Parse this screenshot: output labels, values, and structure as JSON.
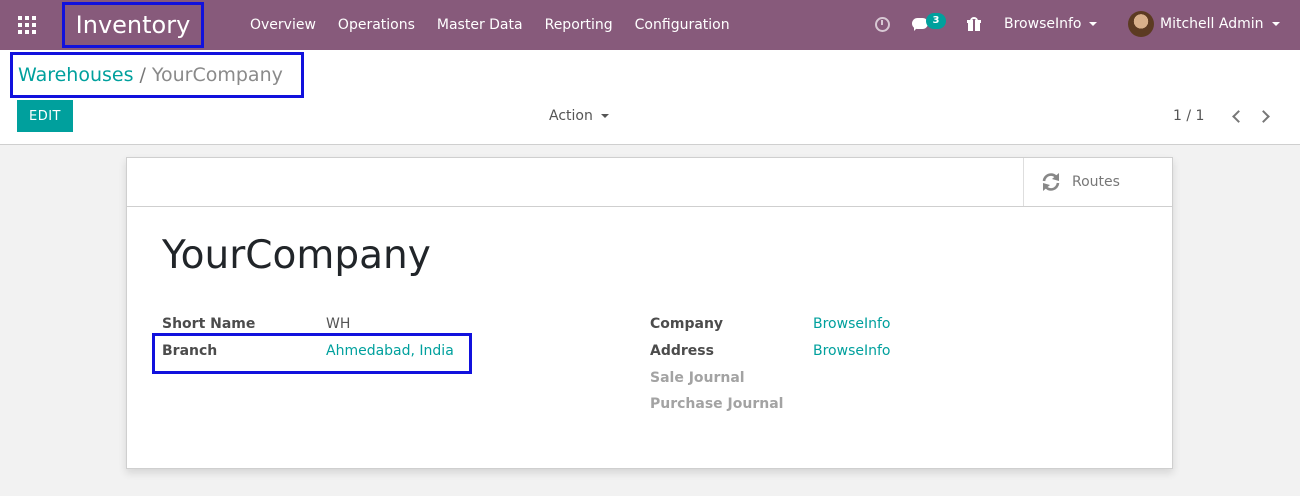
{
  "navbar": {
    "app_title": "Inventory",
    "menu": [
      "Overview",
      "Operations",
      "Master Data",
      "Reporting",
      "Configuration"
    ],
    "messages_count": "3",
    "company": "BrowseInfo",
    "user": "Mitchell Admin",
    "icons": [
      "apps-grid-icon",
      "clock-icon",
      "chat-icon",
      "gift-icon"
    ],
    "bar_color": "#875a7b"
  },
  "breadcrumb": {
    "parent": "Warehouses",
    "separator": "/",
    "current": "YourCompany"
  },
  "toolbar": {
    "edit_label": "EDIT",
    "action_label": "Action",
    "pager": "1 / 1"
  },
  "form": {
    "routes_label": "Routes",
    "title": "YourCompany",
    "left_fields": [
      {
        "label": "Short Name",
        "value": "WH"
      },
      {
        "label": "Branch",
        "value": "Ahmedabad, India"
      }
    ],
    "right_fields": [
      {
        "label": "Company",
        "value": "BrowseInfo"
      },
      {
        "label": "Address",
        "value": "BrowseInfo"
      },
      {
        "label": "Sale Journal",
        "value": ""
      },
      {
        "label": "Purchase Journal",
        "value": ""
      }
    ]
  },
  "colors": {
    "accent": "#00a09d",
    "highlight_border": "#1111dd"
  }
}
